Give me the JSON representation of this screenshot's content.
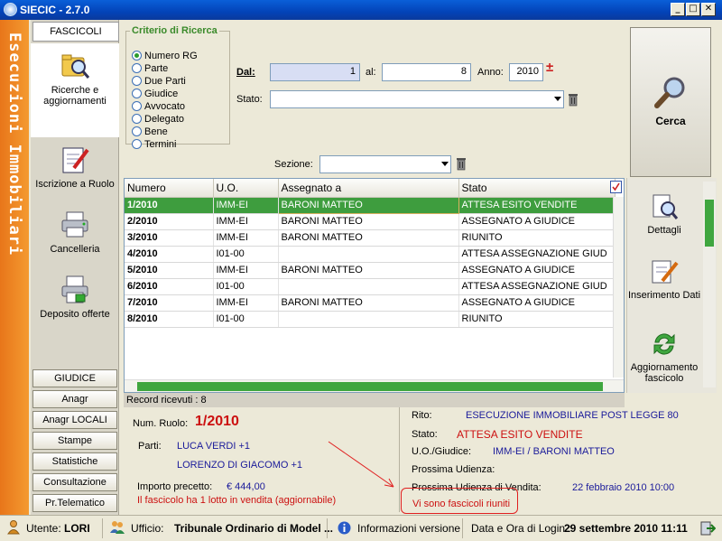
{
  "window": {
    "title": "SIECIC - 2.7.0"
  },
  "banner": {
    "text": "Esecuzioni Immobiliari"
  },
  "nav": {
    "tab": "FASCICOLI",
    "items": [
      {
        "label": "Ricerche e aggiornamenti",
        "icon": "search-folder-icon"
      },
      {
        "label": "Iscrizione a Ruolo",
        "icon": "notepad-pen-icon"
      },
      {
        "label": "Cancelleria",
        "icon": "printer-icon"
      },
      {
        "label": "Deposito offerte",
        "icon": "printer-document-icon"
      }
    ],
    "buttons": [
      "GIUDICE",
      "Anagr DISTRETTO",
      "Anagr LOCALI",
      "Stampe",
      "Statistiche",
      "Consultazione",
      "Pr.Telematico"
    ]
  },
  "criteria": {
    "legend": "Criterio di Ricerca",
    "options": [
      "Numero RG",
      "Parte",
      "Due Parti",
      "Giudice",
      "Avvocato",
      "Delegato",
      "Bene",
      "Termini"
    ],
    "selected": "Numero RG"
  },
  "search": {
    "dal_label": "Dal:",
    "dal_value": "1",
    "al_label": "al:",
    "al_value": "8",
    "anno_label": "Anno:",
    "anno_value": "2010",
    "plusminus": "±",
    "stato_label": "Stato:",
    "stato_value": "",
    "sezione_label": "Sezione:",
    "sezione_value": "",
    "cerca_label": "Cerca"
  },
  "grid": {
    "columns": [
      "Numero",
      "U.O.",
      "Assegnato a",
      "Stato"
    ],
    "rows": [
      [
        "1/2010",
        "IMM-EI",
        "BARONI MATTEO",
        "ATTESA ESITO VENDITE"
      ],
      [
        "2/2010",
        "IMM-EI",
        "BARONI MATTEO",
        "ASSEGNATO A GIUDICE"
      ],
      [
        "3/2010",
        "IMM-EI",
        "BARONI MATTEO",
        "RIUNITO"
      ],
      [
        "4/2010",
        "I01-00",
        "",
        "ATTESA ASSEGNAZIONE GIUD"
      ],
      [
        "5/2010",
        "IMM-EI",
        "BARONI MATTEO",
        "ASSEGNATO A GIUDICE"
      ],
      [
        "6/2010",
        "I01-00",
        "",
        "ATTESA ASSEGNAZIONE GIUD"
      ],
      [
        "7/2010",
        "IMM-EI",
        "BARONI MATTEO",
        "ASSEGNATO A GIUDICE"
      ],
      [
        "8/2010",
        "I01-00",
        "",
        "RIUNITO"
      ]
    ],
    "selected_row": 0,
    "records_label": "Record ricevuti : 8"
  },
  "right_panel": {
    "items": [
      {
        "label": "Dettagli",
        "icon": "magnifier-document-icon"
      },
      {
        "label": "Inserimento Dati",
        "icon": "document-pen-icon"
      },
      {
        "label": "Aggiornamento fascicolo",
        "icon": "green-arrows-icon"
      }
    ]
  },
  "detail": {
    "num_ruolo_label": "Num. Ruolo:",
    "num_ruolo_value": "1/2010",
    "parti_label": "Parti:",
    "parti_1": "LUCA VERDI +1",
    "parti_2": "LORENZO DI GIACOMO +1",
    "importo_label": "Importo precetto:",
    "importo_value": "€ 444,00",
    "lotto_note": "Il fascicolo ha 1 lotto in vendita (aggiornabile)",
    "rito_label": "Rito:",
    "rito_value": "ESECUZIONE IMMOBILIARE POST LEGGE 80",
    "stato_label": "Stato:",
    "stato_value": "ATTESA ESITO VENDITE",
    "uo_label": "U.O./Giudice:",
    "uo_value": "IMM-EI / BARONI MATTEO",
    "prossima_label": "Prossima Udienza:",
    "prossima_value": "",
    "vendita_label": "Prossima Udienza di Vendita:",
    "vendita_value": "22 febbraio 2010 10:00",
    "riuniti_note": "Vi sono fascicoli riuniti"
  },
  "status": {
    "utente_label": "Utente:",
    "utente_value": "LORI",
    "ufficio_label": "Ufficio:",
    "ufficio_value": "Tribunale Ordinario di Model ...",
    "info_label": "Informazioni versione",
    "login_label": "Data e Ora di Login :",
    "login_value": "29 settembre 2010 11:11"
  },
  "colors": {
    "accent_green": "#3e9d3e",
    "banner_orange": "#f08a28",
    "title_blue": "#0343b8",
    "alert_red": "#cc1010",
    "value_navy": "#1a1a9a"
  }
}
